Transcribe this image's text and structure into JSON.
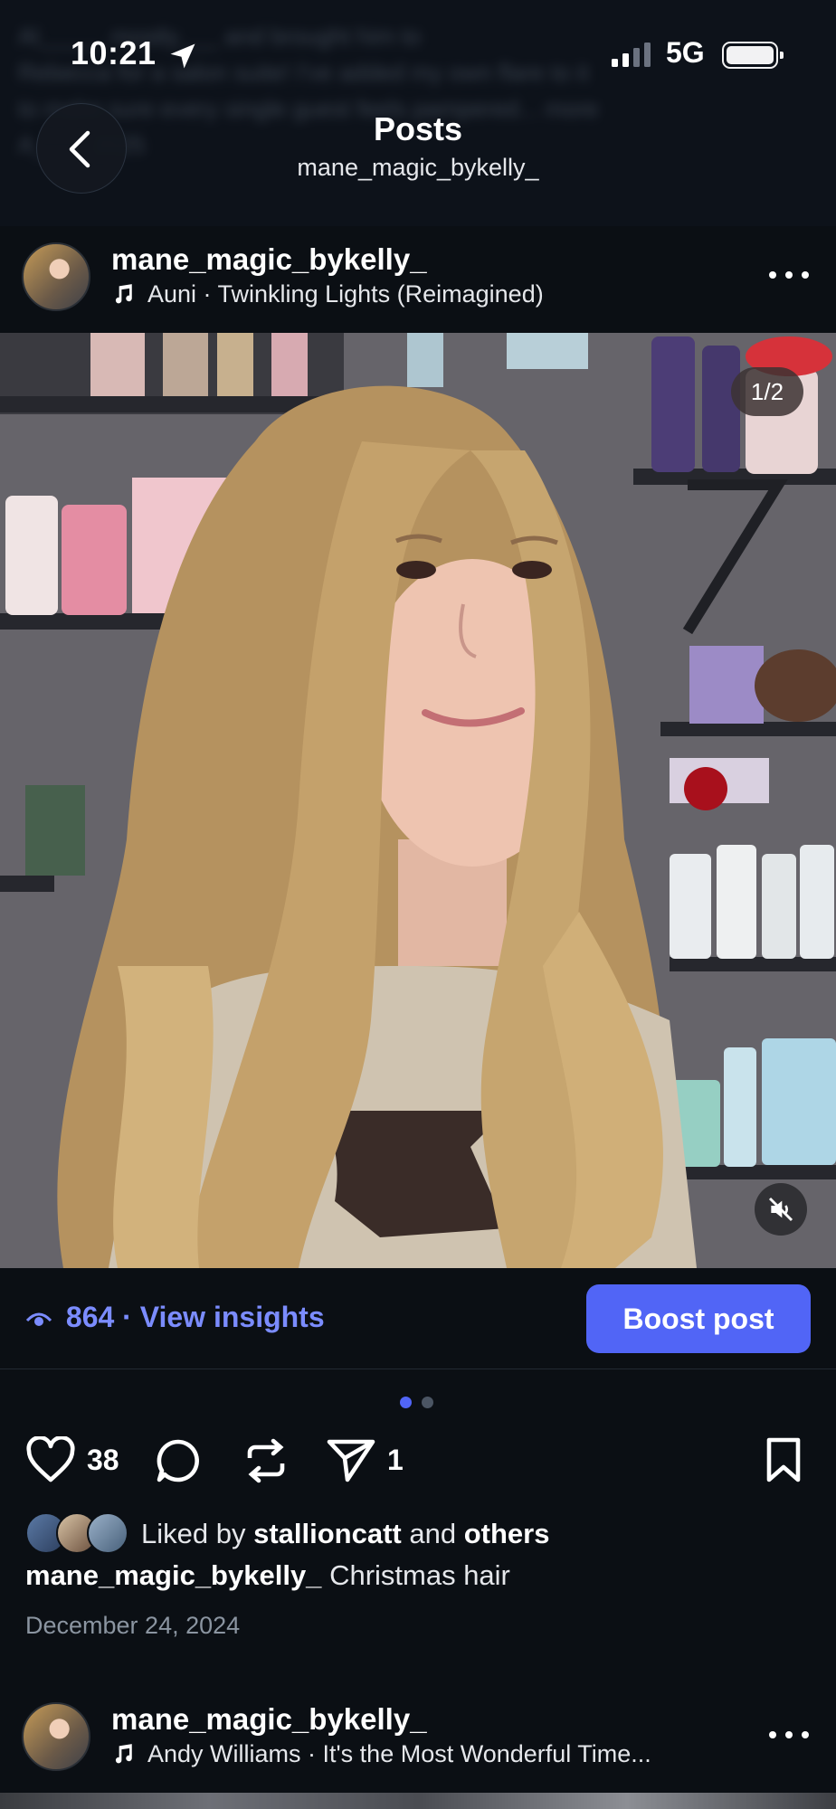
{
  "status_bar": {
    "time": "10:21",
    "network": "5G"
  },
  "header": {
    "title": "Posts",
    "subtitle": "mane_magic_bykelly_"
  },
  "background_blur": {
    "line1": "Al_____ mostly___ and brought him to",
    "line2": "Rebecca for a salon suite! I've added my own flare to it",
    "line3": "to make sure every single guest feels pampered... more",
    "line4": "A____ 2025"
  },
  "post": {
    "username": "mane_magic_bykelly_",
    "music": "Auni · Twinkling Lights (Reimagined)",
    "page_indicator": "1/2",
    "views": "864",
    "view_insights": "· View insights",
    "boost_label": "Boost post",
    "like_count": "38",
    "share_count": "1",
    "liked_by_prefix": "Liked by",
    "liked_by_user": "stallioncatt",
    "liked_by_and": "and",
    "liked_by_others": "others",
    "caption_user": "mane_magic_bykelly_",
    "caption_text": "Christmas hair",
    "date": "December 24, 2024"
  },
  "next_post": {
    "username": "mane_magic_bykelly_",
    "music": "Andy Williams · It's the Most Wonderful Time..."
  },
  "colors": {
    "accent": "#5165f6",
    "link": "#7b8cff",
    "background": "#0b0f14"
  }
}
